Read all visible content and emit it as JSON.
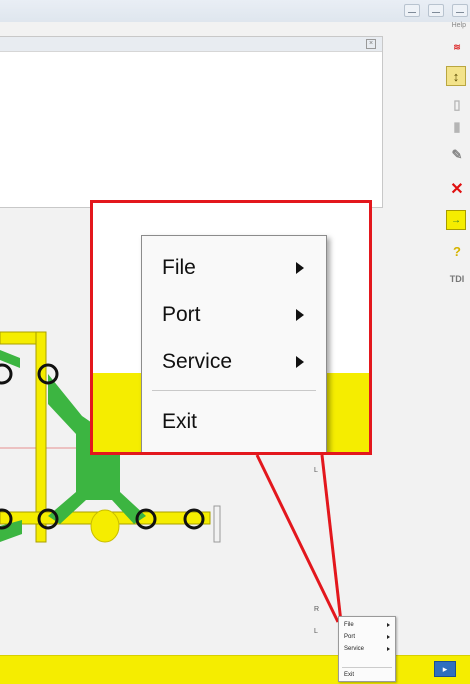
{
  "toolbar": {
    "help_label": "Help",
    "icons": [
      "app-logo-icon",
      "connect-icon",
      "lock-icon",
      "unlock-icon",
      "tool-icon",
      "delete-icon",
      "export-icon",
      "help-icon",
      "tdi-icon"
    ]
  },
  "diagram": {
    "node_labels": [
      "L",
      "R",
      "L"
    ]
  },
  "context_menu": {
    "items": [
      {
        "label": "File",
        "has_submenu": true
      },
      {
        "label": "Port",
        "has_submenu": true
      },
      {
        "label": "Service",
        "has_submenu": true
      },
      {
        "label": "Exit",
        "has_submenu": false
      }
    ]
  },
  "colors": {
    "highlight_border": "#e3171d",
    "frame_yellow": "#f5ed00",
    "chassis_green": "#3cb541"
  }
}
